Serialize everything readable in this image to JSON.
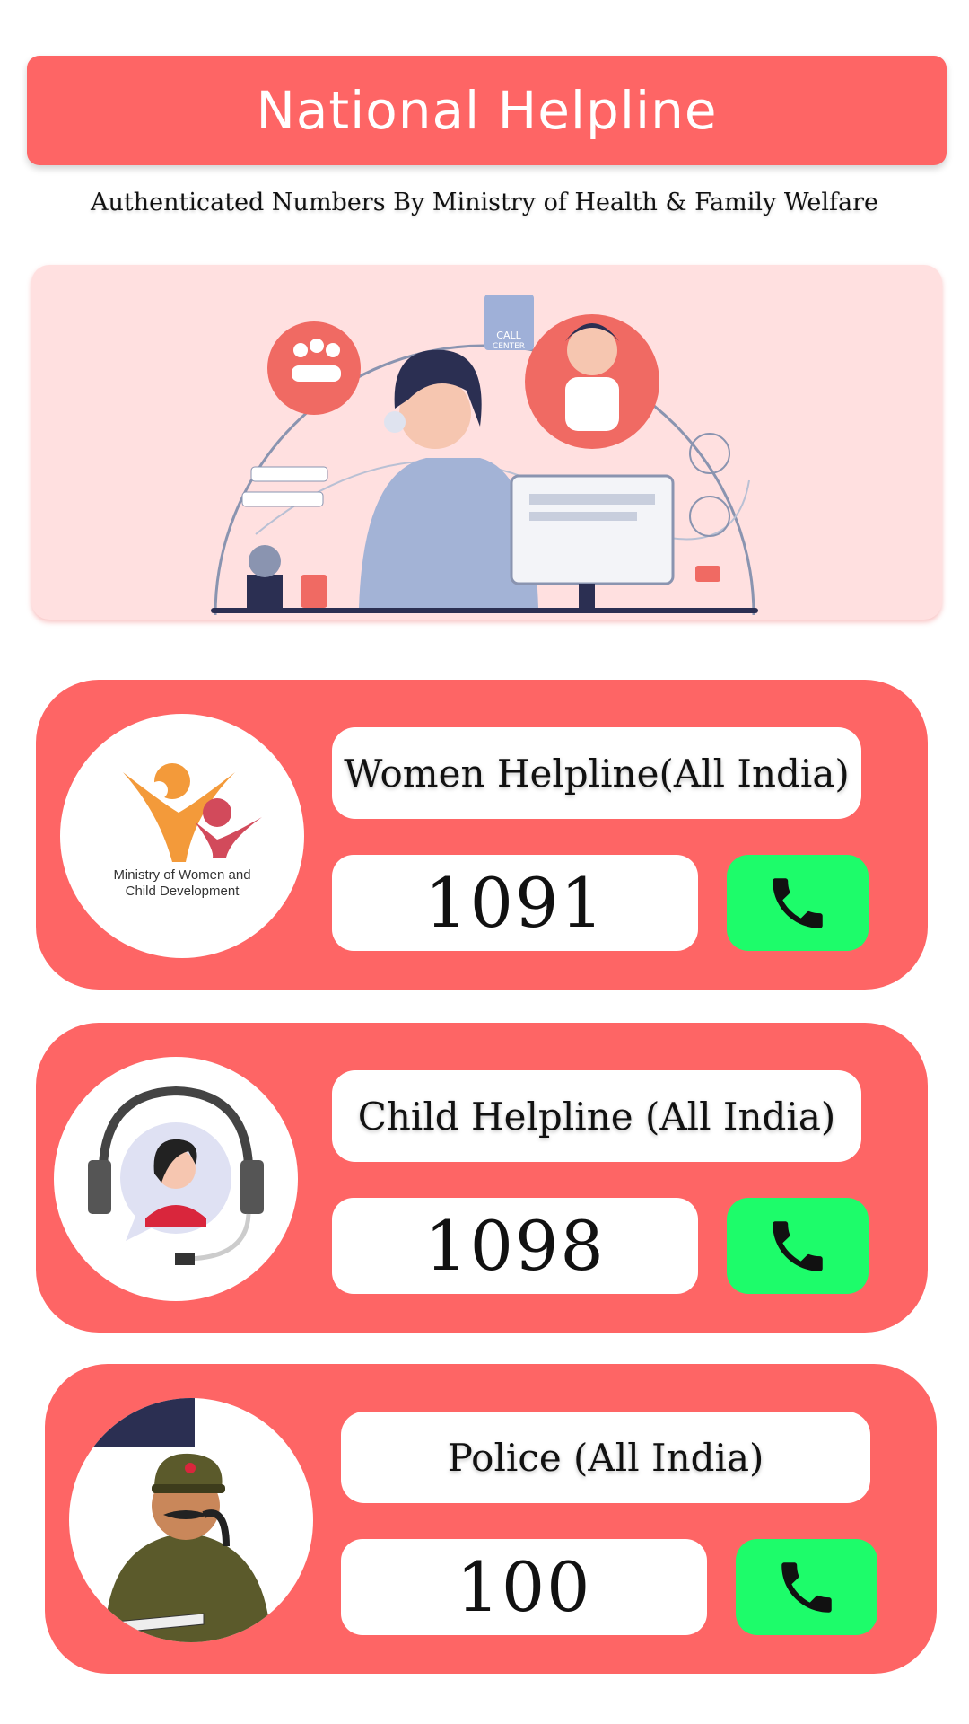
{
  "header": {
    "title": "National Helpline"
  },
  "subtitle": "Authenticated Numbers By Ministry of Health & Family Welfare",
  "hero": {
    "badge_text_1": "CALL",
    "badge_text_2": "CENTER"
  },
  "helplines": [
    {
      "label": "Women Helpline(All India)",
      "number": "1091",
      "logo_line_1": "Ministry of Women and",
      "logo_line_2": "Child Development",
      "icon": "phone-icon"
    },
    {
      "label": "Child Helpline (All India)",
      "number": "1098",
      "icon": "phone-icon"
    },
    {
      "label": "Police (All India)",
      "number": "100",
      "icon": "phone-icon"
    }
  ],
  "colors": {
    "card": "#fe6565",
    "hero_bg": "#ffe0e0",
    "call_button": "#1dfc6a"
  }
}
